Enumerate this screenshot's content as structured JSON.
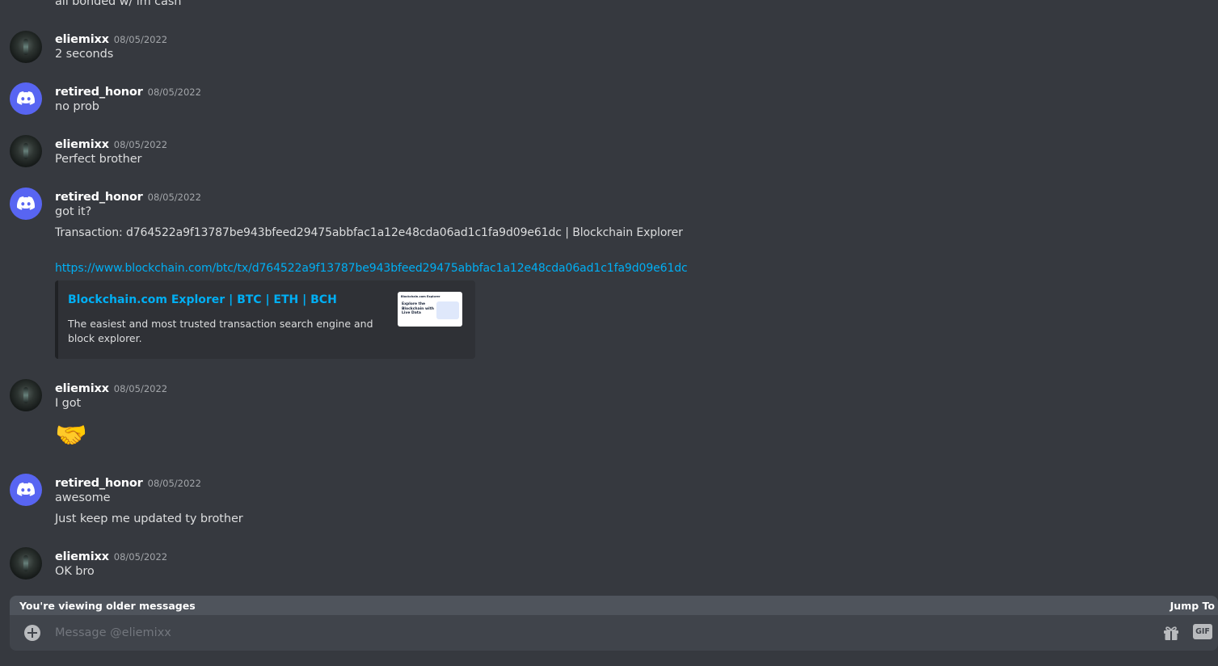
{
  "top_partial_text": "all bonded w/  im cash",
  "messages": [
    {
      "author": "eliemixx",
      "timestamp": "08/05/2022",
      "lines": [
        "2 seconds"
      ]
    },
    {
      "author": "retired_honor",
      "timestamp": "08/05/2022",
      "lines": [
        "no prob"
      ]
    },
    {
      "author": "eliemixx",
      "timestamp": "08/05/2022",
      "lines": [
        "Perfect brother"
      ]
    },
    {
      "author": "retired_honor",
      "timestamp": "08/05/2022",
      "lines": [
        "got it?",
        "Transaction: d764522a9f13787be943bfeed29475abbfac1a12e48cda06ad1c1fa9d09e61dc | Blockchain Explorer"
      ],
      "link": "https://www.blockchain.com/btc/tx/d764522a9f13787be943bfeed29475abbfac1a12e48cda06ad1c1fa9d09e61dc",
      "embed": {
        "title": "Blockchain.com Explorer | BTC | ETH | BCH",
        "description": "The easiest and most trusted transaction search engine and block explorer.",
        "thumb_brand": "Blockchain.com Explorer",
        "thumb_text": "Explore the Blockchain with Live Data"
      }
    },
    {
      "author": "eliemixx",
      "timestamp": "08/05/2022",
      "lines": [
        "I got"
      ],
      "emoji": "🤝"
    },
    {
      "author": "retired_honor",
      "timestamp": "08/05/2022",
      "lines": [
        "awesome",
        "Just keep me updated ty brother"
      ]
    },
    {
      "author": "eliemixx",
      "timestamp": "08/05/2022",
      "lines": [
        "OK bro"
      ]
    }
  ],
  "banner": {
    "text": "You're viewing older messages",
    "jump": "Jump To"
  },
  "composer": {
    "placeholder": "Message @eliemixx",
    "gif_label": "GIF"
  },
  "icons": {
    "add": "plus-circle-icon",
    "gift": "gift-icon",
    "gif": "gif-icon",
    "avatar_default": "discord-logo-icon"
  },
  "colors": {
    "background": "#36393f",
    "link": "#00aff4",
    "blurple": "#5865f2",
    "composer": "#40444b"
  }
}
